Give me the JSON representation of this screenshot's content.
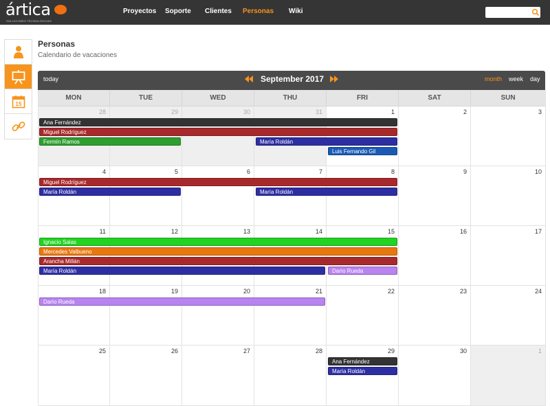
{
  "app": {
    "logo_text": "ártica",
    "logo_subtitle": "SOLUCIONES TECNOLÓGICAS",
    "brand_color": "#f7941d"
  },
  "nav": {
    "items": [
      {
        "label": "Proyectos",
        "active": false
      },
      {
        "label": "Soporte",
        "active": false
      },
      {
        "label": "Clientes",
        "active": false
      },
      {
        "label": "Personas",
        "active": true
      },
      {
        "label": "Wiki",
        "active": false
      }
    ]
  },
  "search": {
    "value": "",
    "placeholder": ""
  },
  "rail": {
    "items": [
      {
        "icon": "person-icon",
        "active": false
      },
      {
        "icon": "presentation-board-icon",
        "active": true
      },
      {
        "icon": "calendar-15-icon",
        "active": false
      },
      {
        "icon": "link-chain-icon",
        "active": false
      }
    ],
    "calendar_icon_number": "15"
  },
  "page": {
    "title": "Personas",
    "subtitle": "Calendario de vacaciones"
  },
  "calendar": {
    "today_label": "today",
    "title": "September 2017",
    "views": [
      {
        "label": "month",
        "active": true
      },
      {
        "label": "week",
        "active": false
      },
      {
        "label": "day",
        "active": false
      }
    ],
    "weekdays": [
      "MON",
      "TUE",
      "WED",
      "THU",
      "FRI",
      "SAT",
      "SUN"
    ],
    "weeks": [
      [
        {
          "d": "28",
          "o": true
        },
        {
          "d": "29",
          "o": true
        },
        {
          "d": "30",
          "o": true
        },
        {
          "d": "31",
          "o": true
        },
        {
          "d": "1",
          "o": false
        },
        {
          "d": "2",
          "o": false
        },
        {
          "d": "3",
          "o": false
        }
      ],
      [
        {
          "d": "4",
          "o": false
        },
        {
          "d": "5",
          "o": false
        },
        {
          "d": "6",
          "o": false
        },
        {
          "d": "7",
          "o": false
        },
        {
          "d": "8",
          "o": false
        },
        {
          "d": "9",
          "o": false
        },
        {
          "d": "10",
          "o": false
        }
      ],
      [
        {
          "d": "11",
          "o": false
        },
        {
          "d": "12",
          "o": false
        },
        {
          "d": "13",
          "o": false
        },
        {
          "d": "14",
          "o": false
        },
        {
          "d": "15",
          "o": false
        },
        {
          "d": "16",
          "o": false
        },
        {
          "d": "17",
          "o": false
        }
      ],
      [
        {
          "d": "18",
          "o": false
        },
        {
          "d": "19",
          "o": false
        },
        {
          "d": "20",
          "o": false
        },
        {
          "d": "21",
          "o": false
        },
        {
          "d": "22",
          "o": false
        },
        {
          "d": "23",
          "o": false
        },
        {
          "d": "24",
          "o": false
        }
      ],
      [
        {
          "d": "25",
          "o": false
        },
        {
          "d": "26",
          "o": false
        },
        {
          "d": "27",
          "o": false
        },
        {
          "d": "28",
          "o": false
        },
        {
          "d": "29",
          "o": false
        },
        {
          "d": "30",
          "o": false
        },
        {
          "d": "1",
          "o": true
        }
      ]
    ],
    "events": [
      {
        "name": "Ana Fernández",
        "week": 0,
        "start": 0,
        "end": 4,
        "row": 0,
        "color": "#333333"
      },
      {
        "name": "Miguel Rodríguez",
        "week": 0,
        "start": 0,
        "end": 4,
        "row": 1,
        "color": "#a8292c"
      },
      {
        "name": "Fermín Ramos",
        "week": 0,
        "start": 0,
        "end": 1,
        "row": 2,
        "color": "#2e9e2e"
      },
      {
        "name": "María Roldán",
        "week": 0,
        "start": 3,
        "end": 4,
        "row": 2,
        "color": "#2e2ea3"
      },
      {
        "name": "Luis Fernando Gil",
        "week": 0,
        "start": 4,
        "end": 4,
        "row": 3,
        "color": "#1a5ab4"
      },
      {
        "name": "Miguel Rodríguez",
        "week": 1,
        "start": 0,
        "end": 4,
        "row": 0,
        "color": "#a8292c"
      },
      {
        "name": "María Roldán",
        "week": 1,
        "start": 0,
        "end": 1,
        "row": 1,
        "color": "#2e2ea3"
      },
      {
        "name": "María Roldán",
        "week": 1,
        "start": 3,
        "end": 4,
        "row": 1,
        "color": "#2e2ea3"
      },
      {
        "name": "Ignacio Salas",
        "week": 2,
        "start": 0,
        "end": 4,
        "row": 0,
        "color": "#22d322"
      },
      {
        "name": "Mercedes Valbueno",
        "week": 2,
        "start": 0,
        "end": 4,
        "row": 1,
        "color": "#e8780e"
      },
      {
        "name": "Arancha Millán",
        "week": 2,
        "start": 0,
        "end": 4,
        "row": 2,
        "color": "#a8292c"
      },
      {
        "name": "María Roldán",
        "week": 2,
        "start": 0,
        "end": 3,
        "row": 3,
        "color": "#2e2ea3"
      },
      {
        "name": "Darío Rueda",
        "week": 2,
        "start": 4,
        "end": 4,
        "row": 3,
        "color": "#b983f0"
      },
      {
        "name": "Darío Rueda",
        "week": 3,
        "start": 0,
        "end": 3,
        "row": 0,
        "color": "#b983f0"
      },
      {
        "name": "Ana Fernández",
        "week": 4,
        "start": 4,
        "end": 4,
        "row": 0,
        "color": "#333333"
      },
      {
        "name": "María Roldán",
        "week": 4,
        "start": 4,
        "end": 4,
        "row": 1,
        "color": "#2e2ea3"
      }
    ]
  }
}
